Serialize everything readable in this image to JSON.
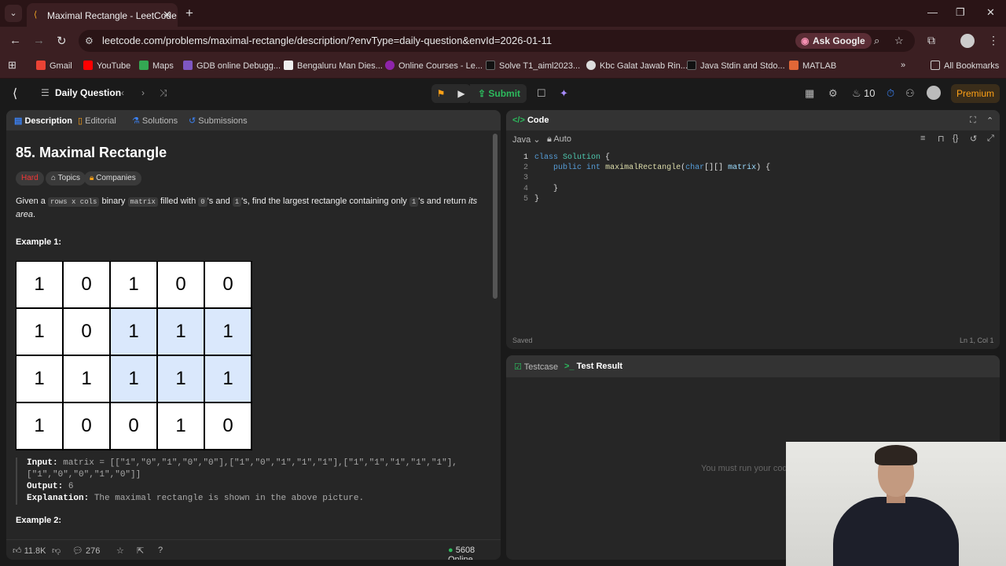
{
  "browser": {
    "tab_title": "Maximal Rectangle - LeetCode",
    "url": "leetcode.com/problems/maximal-rectangle/description/?envType=daily-question&envId=2026-01-11",
    "ask_google": "Ask Google",
    "bookmarks": [
      "Gmail",
      "YouTube",
      "Maps",
      "GDB online Debugg...",
      "Bengaluru Man Dies...",
      "Online Courses - Le...",
      "Solve T1_aiml2023...",
      "Kbc Galat Jawab Rin...",
      "Java Stdin and Stdo...",
      "MATLAB"
    ],
    "all_bookmarks": "All Bookmarks"
  },
  "lc_nav": {
    "daily_question": "Daily Question",
    "submit": "Submit",
    "streak": "10",
    "premium": "Premium"
  },
  "description_panel": {
    "tabs": [
      "Description",
      "Editorial",
      "Solutions",
      "Submissions"
    ],
    "title": "85. Maximal Rectangle",
    "difficulty": "Hard",
    "topics": "Topics",
    "companies": "Companies",
    "text_1": "Given a",
    "code_1": "rows x cols",
    "text_2": "binary",
    "code_2": "matrix",
    "text_3": "filled with",
    "code_3": "0",
    "text_4": "'s and",
    "code_4": "1",
    "text_5": "'s, find the largest rectangle containing only",
    "code_5": "1",
    "text_6": "'s and return",
    "text_7": "its area",
    "text_8": ".",
    "example1": "Example 1:",
    "example2": "Example 2:",
    "matrix": [
      [
        "1",
        "0",
        "1",
        "0",
        "0"
      ],
      [
        "1",
        "0",
        "1",
        "1",
        "1"
      ],
      [
        "1",
        "1",
        "1",
        "1",
        "1"
      ],
      [
        "1",
        "0",
        "0",
        "1",
        "0"
      ]
    ],
    "input_label": "Input:",
    "input_value": "matrix = [[\"1\",\"0\",\"1\",\"0\",\"0\"],[\"1\",\"0\",\"1\",\"1\",\"1\"],[\"1\",\"1\",\"1\",\"1\",\"1\"],",
    "input_value_2": "[\"1\",\"0\",\"0\",\"1\",\"0\"]]",
    "output_label": "Output:",
    "output_value": "6",
    "explanation_label": "Explanation:",
    "explanation_value": "The maximal rectangle is shown in the above picture.",
    "likes": "11.8K",
    "comments": "276",
    "online": "5608 Online"
  },
  "code_panel": {
    "title": "Code",
    "language": "Java",
    "auto": "Auto",
    "saved": "Saved",
    "cursor": "Ln 1, Col 1",
    "line_numbers": [
      "1",
      "2",
      "3",
      "4",
      "5"
    ]
  },
  "test_panel": {
    "tab_testcase": "Testcase",
    "tab_result": "Test Result",
    "message": "You must run your code"
  }
}
